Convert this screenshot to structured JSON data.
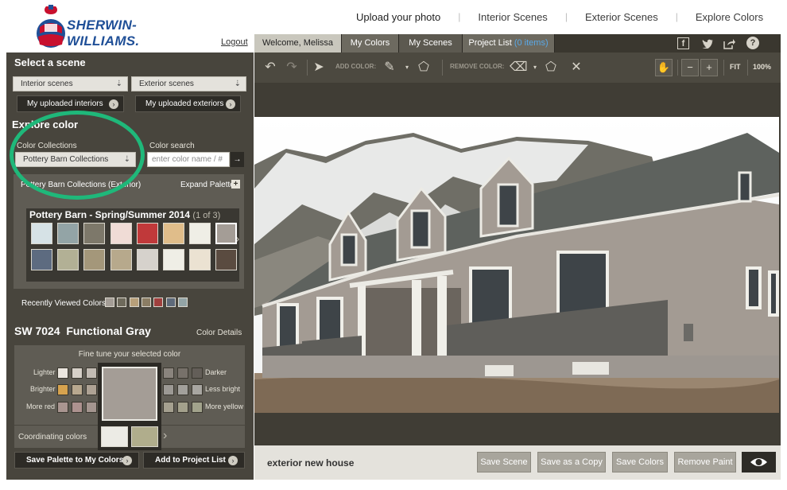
{
  "brand": {
    "name": "SHERWIN-WILLIAMS."
  },
  "topnav": {
    "items": [
      "Upload your photo",
      "Interior Scenes",
      "Exterior Scenes",
      "Explore Colors"
    ]
  },
  "header": {
    "logout": "Logout"
  },
  "tabs": {
    "welcome": "Welcome, Melissa",
    "my_colors": "My Colors",
    "my_scenes": "My Scenes",
    "project_list": "Project List",
    "project_count": "(0 items)"
  },
  "social": {
    "icons": [
      "facebook-icon",
      "twitter-icon",
      "share-icon",
      "help-icon"
    ],
    "help_glyph": "?"
  },
  "sidebar": {
    "select_scene_title": "Select a scene",
    "interior_select": "Interior scenes",
    "exterior_select": "Exterior scenes",
    "uploaded_interiors": "My uploaded interiors",
    "uploaded_exteriors": "My uploaded exteriors",
    "explore_title": "Explore color",
    "collections_label": "Color Collections",
    "collections_value": "Pottery Barn Collections",
    "search_label": "Color search",
    "search_placeholder": "enter color name / #",
    "palette_header": "Pottery Barn Collections (Exterior)",
    "expand_palette": "Expand Palette",
    "palette_name": "Pottery Barn - Spring/Summer 2014",
    "palette_page": "(1 of 3)",
    "palette_row1": [
      "#d6e2e6",
      "#93a4a6",
      "#7d786a",
      "#f0dcd6",
      "#c0393a",
      "#e0bd8a",
      "#efeee6",
      "#a49d96"
    ],
    "palette_row2": [
      "#5d6b80",
      "#b2b095",
      "#a4977a",
      "#b7a98c",
      "#d6d2cc",
      "#efeee6",
      "#ebe2d2",
      "#5a4b40"
    ],
    "recent_label": "Recently Viewed Colors",
    "recent_colors": [
      "#a49d96",
      "#6e6a5c",
      "#b8a07a",
      "#8b7d64",
      "#a0403e",
      "#5e6a7a",
      "#93a4a6"
    ],
    "color_code": "SW 7024",
    "color_name": "Functional Gray",
    "color_details": "Color Details",
    "fine_tune_title": "Fine tune your selected color",
    "lighter": "Lighter",
    "darker": "Darker",
    "brighter": "Brighter",
    "less_bright": "Less bright",
    "more_red": "More red",
    "more_yellow": "More yellow",
    "selected_color": "#a49d96",
    "lighter_chips": [
      "#ebe6df",
      "#d6d0c8",
      "#c2bbb3"
    ],
    "darker_chips": [
      "#8a847d",
      "#77716a",
      "#635e58"
    ],
    "brighter_chips": [
      "#d6a24e",
      "#b8a88f",
      "#aea294"
    ],
    "less_bright_chips": [
      "#9c9994",
      "#a2a09b",
      "#a8a6a1"
    ],
    "more_red_chips": [
      "#a99590",
      "#ad928f",
      "#a4958f"
    ],
    "more_yellow_chips": [
      "#a5a08f",
      "#a4a18c",
      "#a2a38c"
    ],
    "coordinating_label": "Coordinating colors",
    "coordinating_colors": [
      "#ecebe5",
      "#b0ad8c"
    ],
    "save_palette": "Save Palette to My Colors",
    "add_project": "Add to Project List"
  },
  "toolbar": {
    "add_color": "ADD COLOR:",
    "remove_color": "REMOVE COLOR:",
    "fit": "FIT",
    "zoom": "100%"
  },
  "scene": {
    "name": "exterior new house"
  },
  "actions": {
    "save_scene": "Save Scene",
    "save_copy": "Save as a Copy",
    "save_colors": "Save Colors",
    "remove_paint": "Remove Paint"
  }
}
